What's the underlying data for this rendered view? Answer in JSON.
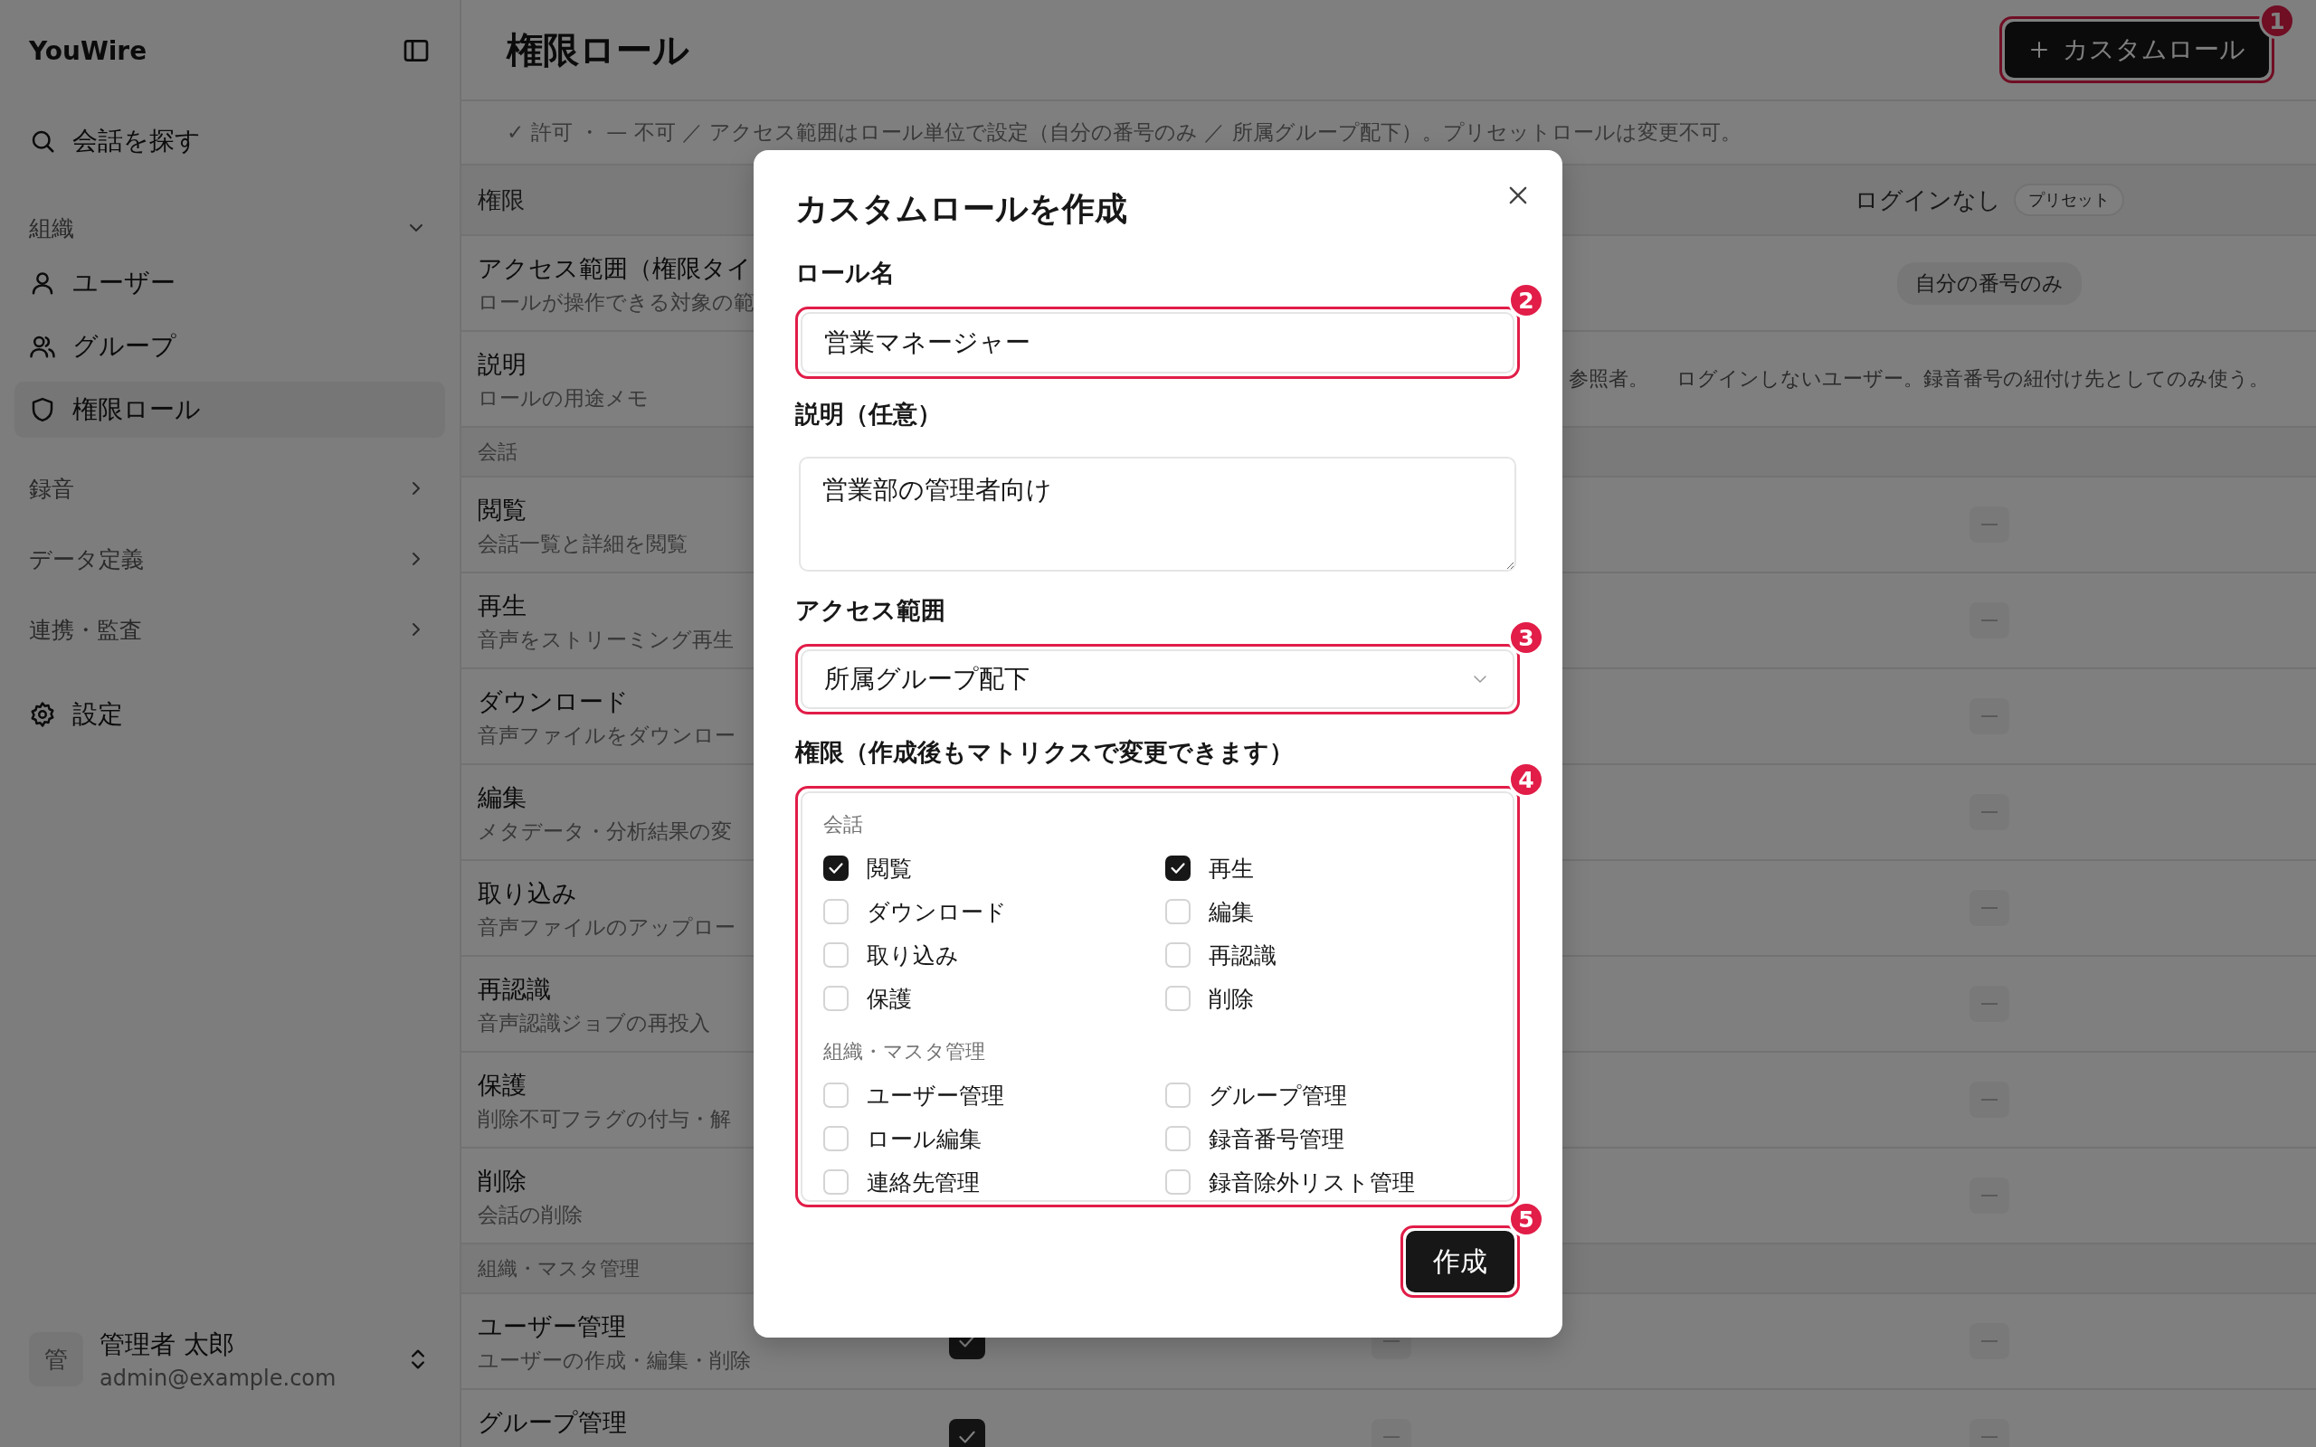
{
  "sidebar": {
    "brand": "YouWire",
    "search": "会話を探す",
    "sections": [
      {
        "label": "組織",
        "expanded": true,
        "children": [
          {
            "label": "ユーザー",
            "selected": false
          },
          {
            "label": "グループ",
            "selected": false
          },
          {
            "label": "権限ロール",
            "selected": true
          }
        ]
      },
      {
        "label": "録音",
        "expanded": false
      },
      {
        "label": "データ定義",
        "expanded": false
      },
      {
        "label": "連携・監査",
        "expanded": false
      }
    ],
    "settings": "設定",
    "user": {
      "avatar": "管",
      "name": "管理者 太郎",
      "email": "admin@example.com"
    }
  },
  "header": {
    "title": "権限ロール",
    "action": {
      "label": "カスタムロール",
      "callout": "1"
    }
  },
  "legend": "✓ 許可 ・ — 不可 ／ アクセス範囲はロール単位で設定（自分の番号のみ ／ 所属グループ配下）。プリセットロールは変更不可。",
  "table": {
    "columns": {
      "column_1": {
        "label": "権限"
      },
      "column_4": {
        "label": "ログインなし",
        "badge": "プリセット"
      }
    },
    "rows": [
      {
        "kind": "permission",
        "title": "アクセス範囲（権限タイ",
        "description": "ロールが操作できる対象の範",
        "column_4": {
          "kind": "pill",
          "text": "自分の番号のみ"
        }
      },
      {
        "kind": "permission",
        "title": "説明",
        "description": "ロールの用途メモ",
        "column_3": {
          "kind": "text",
          "text": "参照者。"
        },
        "column_4": {
          "kind": "text",
          "text": "ログインしないユーザー。録音番号の紐付け先としてのみ使う。"
        }
      },
      {
        "kind": "section",
        "label": "会話"
      },
      {
        "kind": "permission",
        "title": "閲覧",
        "description": "会話一覧と詳細を閲覧",
        "column_4": {
          "kind": "denied"
        }
      },
      {
        "kind": "permission",
        "title": "再生",
        "description": "音声をストリーミング再生",
        "column_4": {
          "kind": "denied"
        }
      },
      {
        "kind": "permission",
        "title": "ダウンロード",
        "description": "音声ファイルをダウンロー",
        "column_4": {
          "kind": "denied"
        }
      },
      {
        "kind": "permission",
        "title": "編集",
        "description": "メタデータ・分析結果の変",
        "column_4": {
          "kind": "denied"
        }
      },
      {
        "kind": "permission",
        "title": "取り込み",
        "description": "音声ファイルのアップロー",
        "column_4": {
          "kind": "denied"
        }
      },
      {
        "kind": "permission",
        "title": "再認識",
        "description": "音声認識ジョブの再投入",
        "column_4": {
          "kind": "denied"
        }
      },
      {
        "kind": "permission",
        "title": "保護",
        "description": "削除不可フラグの付与・解",
        "column_4": {
          "kind": "denied"
        }
      },
      {
        "kind": "permission",
        "title": "削除",
        "description": "会話の削除",
        "column_4": {
          "kind": "denied"
        }
      },
      {
        "kind": "section",
        "label": "組織・マスタ管理"
      },
      {
        "kind": "permission",
        "title": "ユーザー管理",
        "description": "ユーザーの作成・編集・削除",
        "column_2": {
          "kind": "allowed"
        },
        "column_3": {
          "kind": "denied"
        },
        "column_4": {
          "kind": "denied"
        }
      },
      {
        "kind": "permission",
        "title": "グループ管理",
        "column_2": {
          "kind": "allowed"
        },
        "column_3": {
          "kind": "denied"
        },
        "column_4": {
          "kind": "denied"
        }
      }
    ]
  },
  "dialog": {
    "title": "カスタムロールを作成",
    "name": {
      "label": "ロール名",
      "value": "営業マネージャー",
      "callout": "2"
    },
    "description": {
      "label": "説明（任意）",
      "value": "営業部の管理者向け"
    },
    "scope": {
      "label": "アクセス範囲",
      "value": "所属グループ配下",
      "callout": "3"
    },
    "permissions": {
      "label": "権限（作成後もマトリクスで変更できます）",
      "callout": "4",
      "groups": [
        {
          "label": "会話",
          "items": [
            {
              "label": "閲覧",
              "checked": true
            },
            {
              "label": "再生",
              "checked": true
            },
            {
              "label": "ダウンロード",
              "checked": false
            },
            {
              "label": "編集",
              "checked": false
            },
            {
              "label": "取り込み",
              "checked": false
            },
            {
              "label": "再認識",
              "checked": false
            },
            {
              "label": "保護",
              "checked": false
            },
            {
              "label": "削除",
              "checked": false
            }
          ]
        },
        {
          "label": "組織・マスタ管理",
          "items": [
            {
              "label": "ユーザー管理",
              "checked": false
            },
            {
              "label": "グループ管理",
              "checked": false
            },
            {
              "label": "ロール編集",
              "checked": false
            },
            {
              "label": "録音番号管理",
              "checked": false
            },
            {
              "label": "連絡先管理",
              "checked": false
            },
            {
              "label": "録音除外リスト管理",
              "checked": false
            }
          ]
        }
      ]
    },
    "submit": {
      "label": "作成",
      "callout": "5"
    }
  }
}
